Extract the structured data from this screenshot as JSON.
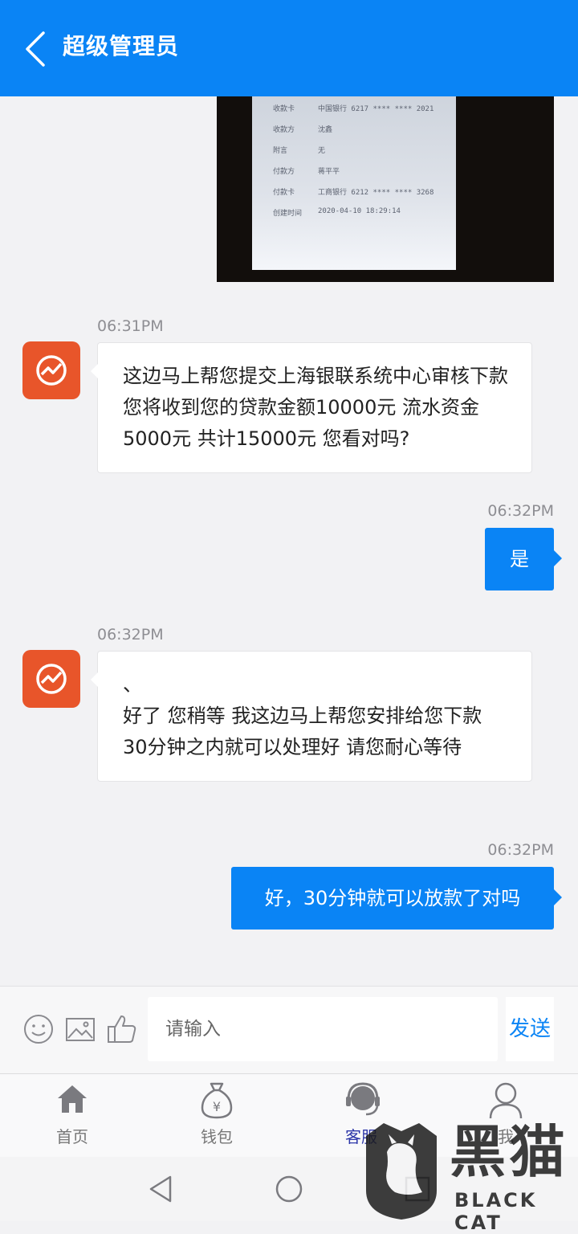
{
  "header": {
    "title": "超级管理员",
    "back_icon": "chevron-left-icon"
  },
  "photo": {
    "rows": [
      {
        "label": "收款卡",
        "value": "中国银行 6217 **** **** 2021"
      },
      {
        "label": "收款方",
        "value": "沈鑫"
      },
      {
        "label": "附言",
        "value": "无"
      },
      {
        "label": "付款方",
        "value": "蒋平平"
      },
      {
        "label": "付款卡",
        "value": "工商银行 6212 **** **** 3268"
      },
      {
        "label": "创建时间",
        "value": "2020-04-10 18:29:14"
      }
    ]
  },
  "messages": [
    {
      "side": "in",
      "time": "06:31PM",
      "text": "这边马上帮您提交上海银联系统中心审核下款 您将收到您的贷款金额10000元 流水资金5000元 共计15000元 您看对吗?"
    },
    {
      "side": "out",
      "time": "06:32PM",
      "text": "是"
    },
    {
      "side": "in",
      "time": "06:32PM",
      "text": "、\n好了 您稍等 我这边马上帮您安排给您下款 30分钟之内就可以处理好 请您耐心等待"
    },
    {
      "side": "out",
      "time": "06:32PM",
      "text": "好，30分钟就可以放款了对吗"
    }
  ],
  "input": {
    "placeholder": "请输入",
    "value": "",
    "send_label": "发送"
  },
  "tabs": [
    {
      "label": "首页",
      "icon": "home-icon",
      "active": false
    },
    {
      "label": "钱包",
      "icon": "money-bag-icon",
      "active": false
    },
    {
      "label": "客服",
      "icon": "customer-service-icon",
      "active": true
    },
    {
      "label": "我",
      "icon": "user-icon",
      "active": false
    }
  ],
  "watermark": {
    "cn": "黑猫",
    "en": "BLACK CAT"
  },
  "colors": {
    "primary": "#0a84f5",
    "avatar": "#e8552a",
    "active_tab": "#2c36a8"
  }
}
